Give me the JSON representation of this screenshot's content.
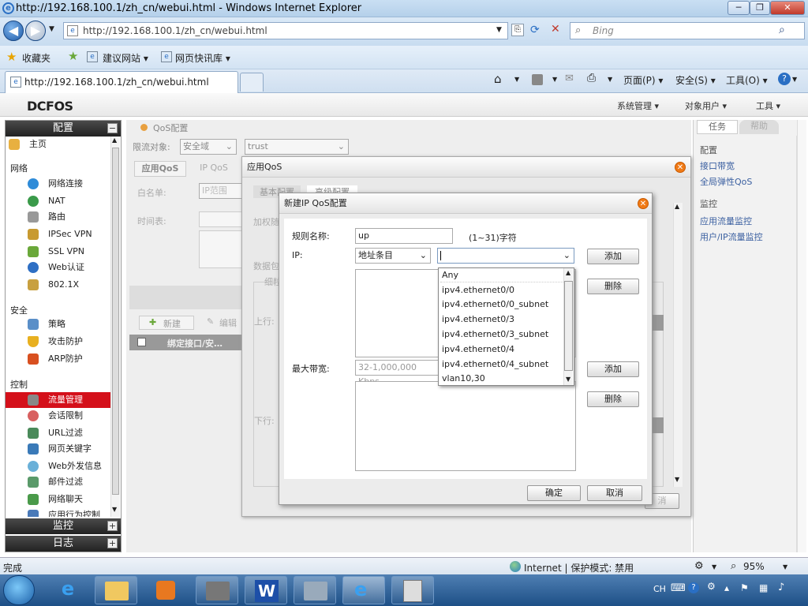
{
  "browser": {
    "title": "http://192.168.100.1/zh_cn/webui.html - Windows Internet Explorer",
    "address": "http://192.168.100.1/zh_cn/webui.html",
    "search_placeholder": "Bing",
    "favorites_label": "收藏夹",
    "fav_links": [
      "建议网站 ▾",
      "网页快讯库 ▾"
    ],
    "tab_label": "http://192.168.100.1/zh_cn/webui.html",
    "cmd_menus": [
      "页面(P) ▾",
      "安全(S) ▾",
      "工具(O) ▾"
    ],
    "status_left": "完成",
    "status_zone": "Internet | 保护模式: 禁用",
    "zoom": "95%"
  },
  "app": {
    "logo": "DCFOS",
    "top_menus": [
      "系统管理 ▾",
      "对象用户 ▾",
      "工具 ▾"
    ],
    "sidebar": {
      "head_config": "配置",
      "head_monitor": "监控",
      "head_log": "日志",
      "home": "主页",
      "sec_network": "网络",
      "network_items": [
        "网络连接",
        "NAT",
        "路由",
        "IPSec VPN",
        "SSL VPN",
        "Web认证",
        "802.1X"
      ],
      "sec_security": "安全",
      "security_items": [
        "策略",
        "攻击防护",
        "ARP防护"
      ],
      "sec_control": "控制",
      "control_items": [
        "流量管理",
        "会话限制",
        "URL过滤",
        "网页关键字",
        "Web外发信息",
        "邮件过滤",
        "网络聊天",
        "应用行为控制"
      ]
    },
    "main": {
      "breadcrumb": "QoS配置",
      "limit_label": "限流对象:",
      "limit_value": "安全域",
      "zone_value": "trust",
      "tab_app": "应用QoS",
      "tab_ip": "IP QoS",
      "whitelist_label": "白名单:",
      "whitelist_value": "IP范围",
      "schedule_label": "时间表:",
      "new_btn": "新建",
      "edit_btn": "编辑",
      "col_bind": "绑定接口/安…"
    },
    "right": {
      "tab_task": "任务",
      "tab_help": "帮助",
      "sec_config": "配置",
      "config_links": [
        "接口带宽",
        "全局弹性QoS"
      ],
      "sec_monitor": "监控",
      "monitor_links": [
        "应用流量监控",
        "用户/IP流量监控"
      ]
    }
  },
  "dialog1": {
    "title": "应用QoS",
    "tab_basic": "基本配置",
    "tab_adv": "高级配置",
    "l_weight": "加权随",
    "l_packet": "数据包",
    "l_fine": "细粒",
    "btn_cancel": "消"
  },
  "dialog2": {
    "title": "新建IP QoS配置",
    "rule_label": "规则名称:",
    "rule_value": "up",
    "rule_hint": "(1~31)字符",
    "ip_label": "IP:",
    "ip_type": "地址条目",
    "ip_value": "",
    "add_btn": "添加",
    "del_btn": "删除",
    "up_label": "上行:",
    "maxbw_label": "最大带宽:",
    "maxbw_placeholder": "32-1,000,000 Kbps",
    "down_label": "下行:",
    "ok_btn": "确定",
    "cancel_btn": "取消",
    "dropdown_options": [
      "Any",
      "ipv4.ethernet0/0",
      "ipv4.ethernet0/0_subnet",
      "ipv4.ethernet0/3",
      "ipv4.ethernet0/3_subnet",
      "ipv4.ethernet0/4",
      "ipv4.ethernet0/4_subnet",
      "vlan10,30"
    ]
  },
  "taskbar": {
    "lang": "CH"
  },
  "colors": {
    "accent_red": "#d4101a",
    "link_blue": "#3a5fa0",
    "close_orange": "#f07a16"
  }
}
